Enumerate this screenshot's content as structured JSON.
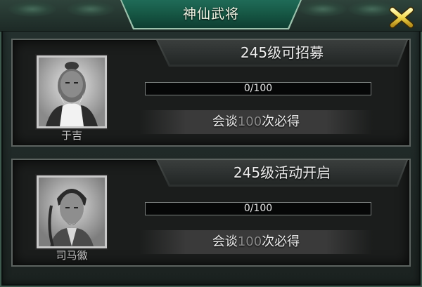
{
  "window": {
    "title": "神仙武将",
    "close_icon": "close-x-icon",
    "accent_color": "#f2d84b"
  },
  "generals": [
    {
      "name": "于吉",
      "banner": "245级可招募",
      "progress_text": "0/100",
      "progress_value": 0,
      "progress_max": 100,
      "talk_prefix": "会谈",
      "talk_count": "100",
      "talk_suffix": "次必得"
    },
    {
      "name": "司马徽",
      "banner": "245级活动开启",
      "progress_text": "0/100",
      "progress_value": 0,
      "progress_max": 100,
      "talk_prefix": "会谈",
      "talk_count": "100",
      "talk_suffix": "次必得"
    }
  ]
}
